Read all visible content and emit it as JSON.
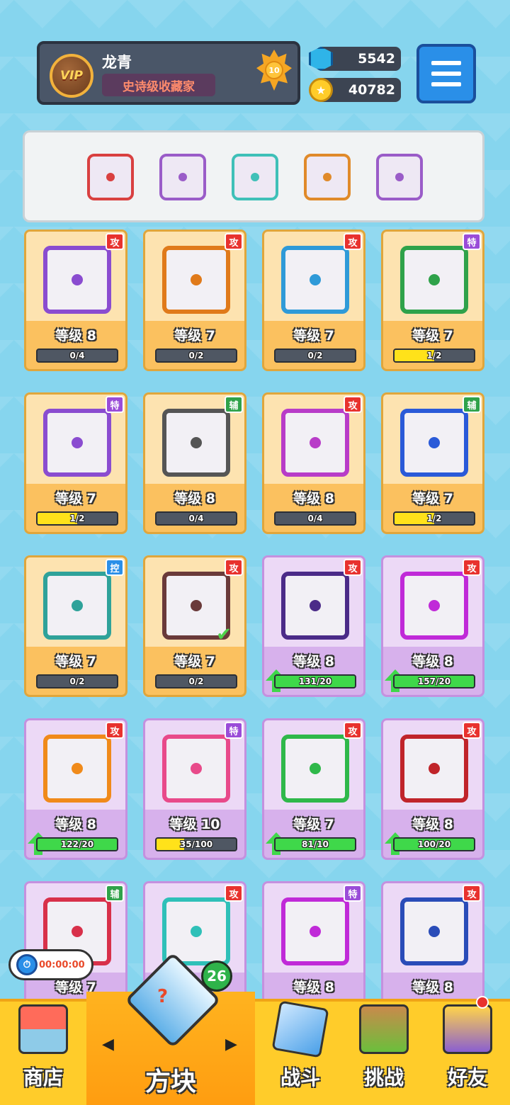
{
  "profile": {
    "vip": "VIP",
    "name": "龙青",
    "title": "史诗级收藏家",
    "rank": "10"
  },
  "currency": {
    "gems": "5542",
    "coins": "40782"
  },
  "equipped": [
    {
      "color": "#d94040"
    },
    {
      "color": "#9a5cc8"
    },
    {
      "color": "#3fc0b8"
    },
    {
      "color": "#e08a2a"
    },
    {
      "color": "#9a5cc8"
    }
  ],
  "cards": [
    {
      "level": "等级 8",
      "progress": "0/4",
      "ratio": 0,
      "tag": "攻",
      "tag_color": "#e8322e",
      "rarity": "gold",
      "frame": "#8a4cd0",
      "bar": "normal"
    },
    {
      "level": "等级 7",
      "progress": "0/2",
      "ratio": 0,
      "tag": "攻",
      "tag_color": "#e8322e",
      "rarity": "gold",
      "frame": "#e07a1a",
      "bar": "normal"
    },
    {
      "level": "等级 7",
      "progress": "0/2",
      "ratio": 0,
      "tag": "攻",
      "tag_color": "#e8322e",
      "rarity": "gold",
      "frame": "#2f9ad8",
      "bar": "normal"
    },
    {
      "level": "等级 7",
      "progress": "1/2",
      "ratio": 0.5,
      "tag": "特",
      "tag_color": "#9a4cd8",
      "rarity": "gold",
      "frame": "#2fa24a",
      "bar": "normal"
    },
    {
      "level": "等级 7",
      "progress": "1/2",
      "ratio": 0.5,
      "tag": "特",
      "tag_color": "#9a4cd8",
      "rarity": "gold",
      "frame": "#8a4cd0",
      "bar": "normal"
    },
    {
      "level": "等级 8",
      "progress": "0/4",
      "ratio": 0,
      "tag": "辅",
      "tag_color": "#2fa24a",
      "rarity": "gold",
      "frame": "#555555",
      "bar": "normal"
    },
    {
      "level": "等级 8",
      "progress": "0/4",
      "ratio": 0,
      "tag": "攻",
      "tag_color": "#e8322e",
      "rarity": "gold",
      "frame": "#b83cc8",
      "bar": "normal"
    },
    {
      "level": "等级 7",
      "progress": "1/2",
      "ratio": 0.5,
      "tag": "辅",
      "tag_color": "#2fa24a",
      "rarity": "gold",
      "frame": "#2a5ad8",
      "bar": "normal"
    },
    {
      "level": "等级 7",
      "progress": "0/2",
      "ratio": 0,
      "tag": "控",
      "tag_color": "#2a8fe8",
      "rarity": "gold",
      "frame": "#2fa29a",
      "bar": "normal"
    },
    {
      "level": "等级 7",
      "progress": "0/2",
      "ratio": 0,
      "tag": "攻",
      "tag_color": "#e8322e",
      "rarity": "gold",
      "frame": "#6a3a3a",
      "bar": "normal",
      "equipped": true
    },
    {
      "level": "等级 8",
      "progress": "131/20",
      "ratio": 1,
      "tag": "攻",
      "tag_color": "#e8322e",
      "rarity": "purple",
      "frame": "#4b2b88",
      "bar": "green"
    },
    {
      "level": "等级 8",
      "progress": "157/20",
      "ratio": 1,
      "tag": "攻",
      "tag_color": "#e8322e",
      "rarity": "purple",
      "frame": "#c02ad8",
      "bar": "green"
    },
    {
      "level": "等级 8",
      "progress": "122/20",
      "ratio": 1,
      "tag": "攻",
      "tag_color": "#e8322e",
      "rarity": "purple",
      "frame": "#f08a1a",
      "bar": "green"
    },
    {
      "level": "等级 10",
      "progress": "35/100",
      "ratio": 0.35,
      "tag": "特",
      "tag_color": "#9a4cd8",
      "rarity": "purple",
      "frame": "#e84a8a",
      "bar": "normal"
    },
    {
      "level": "等级 7",
      "progress": "81/10",
      "ratio": 1,
      "tag": "攻",
      "tag_color": "#e8322e",
      "rarity": "purple",
      "frame": "#2fb84a",
      "bar": "green"
    },
    {
      "level": "等级 8",
      "progress": "100/20",
      "ratio": 1,
      "tag": "攻",
      "tag_color": "#e8322e",
      "rarity": "purple",
      "frame": "#c0242a",
      "bar": "green"
    },
    {
      "level": "等级 7",
      "progress": "",
      "ratio": 0,
      "tag": "辅",
      "tag_color": "#2fa24a",
      "rarity": "purple",
      "frame": "#d8304a",
      "bar": "normal"
    },
    {
      "level": "",
      "progress": "",
      "ratio": 0,
      "tag": "攻",
      "tag_color": "#e8322e",
      "rarity": "purple",
      "frame": "#2fc0b8",
      "bar": "normal"
    },
    {
      "level": "等级 8",
      "progress": "",
      "ratio": 0,
      "tag": "特",
      "tag_color": "#9a4cd8",
      "rarity": "purple",
      "frame": "#c02ad8",
      "bar": "normal"
    },
    {
      "level": "等级 8",
      "progress": "",
      "ratio": 0,
      "tag": "攻",
      "tag_color": "#e8322e",
      "rarity": "purple",
      "frame": "#2a4cb8",
      "bar": "normal"
    }
  ],
  "timer": "00:00:00",
  "nav": {
    "shop": "商店",
    "blocks": "方块",
    "battle": "战斗",
    "challenge": "挑战",
    "friends": "好友",
    "box_count": "26",
    "arrow_left": "◀",
    "arrow_right": "▶"
  }
}
